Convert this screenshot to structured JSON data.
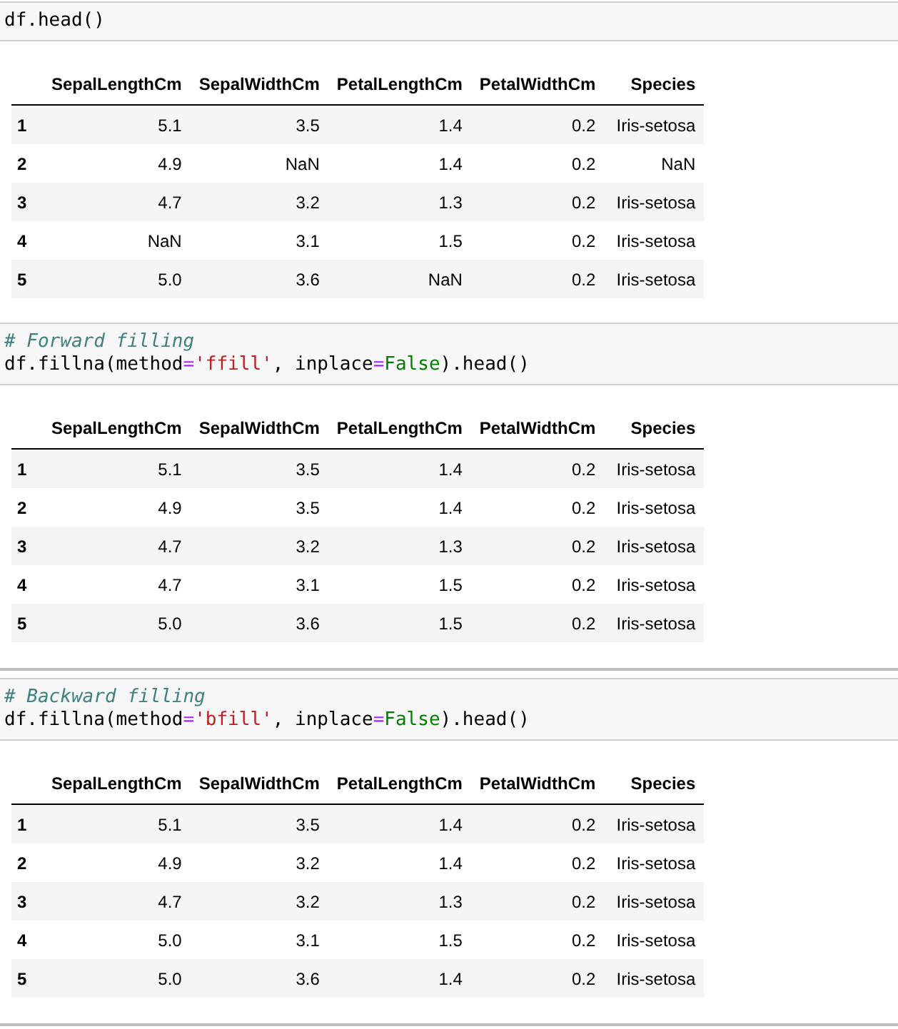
{
  "cells": [
    {
      "code": [
        [
          {
            "kind": "plain",
            "text": "df.head()"
          }
        ]
      ],
      "columns": [
        "SepalLengthCm",
        "SepalWidthCm",
        "PetalLengthCm",
        "PetalWidthCm",
        "Species"
      ],
      "rows": [
        {
          "index": "1",
          "values": [
            "5.1",
            "3.5",
            "1.4",
            "0.2",
            "Iris-setosa"
          ]
        },
        {
          "index": "2",
          "values": [
            "4.9",
            "NaN",
            "1.4",
            "0.2",
            "NaN"
          ]
        },
        {
          "index": "3",
          "values": [
            "4.7",
            "3.2",
            "1.3",
            "0.2",
            "Iris-setosa"
          ]
        },
        {
          "index": "4",
          "values": [
            "NaN",
            "3.1",
            "1.5",
            "0.2",
            "Iris-setosa"
          ]
        },
        {
          "index": "5",
          "values": [
            "5.0",
            "3.6",
            "NaN",
            "0.2",
            "Iris-setosa"
          ]
        }
      ]
    },
    {
      "code": [
        [
          {
            "kind": "comment",
            "text": "# Forward filling"
          }
        ],
        [
          {
            "kind": "plain",
            "text": "df.fillna(method"
          },
          {
            "kind": "operator",
            "text": "="
          },
          {
            "kind": "string",
            "text": "'ffill'"
          },
          {
            "kind": "plain",
            "text": ", inplace"
          },
          {
            "kind": "operator",
            "text": "="
          },
          {
            "kind": "constant",
            "text": "False"
          },
          {
            "kind": "plain",
            "text": ").head()"
          }
        ]
      ],
      "columns": [
        "SepalLengthCm",
        "SepalWidthCm",
        "PetalLengthCm",
        "PetalWidthCm",
        "Species"
      ],
      "rows": [
        {
          "index": "1",
          "values": [
            "5.1",
            "3.5",
            "1.4",
            "0.2",
            "Iris-setosa"
          ]
        },
        {
          "index": "2",
          "values": [
            "4.9",
            "3.5",
            "1.4",
            "0.2",
            "Iris-setosa"
          ]
        },
        {
          "index": "3",
          "values": [
            "4.7",
            "3.2",
            "1.3",
            "0.2",
            "Iris-setosa"
          ]
        },
        {
          "index": "4",
          "values": [
            "4.7",
            "3.1",
            "1.5",
            "0.2",
            "Iris-setosa"
          ]
        },
        {
          "index": "5",
          "values": [
            "5.0",
            "3.6",
            "1.5",
            "0.2",
            "Iris-setosa"
          ]
        }
      ]
    },
    {
      "code": [
        [
          {
            "kind": "comment",
            "text": "# Backward filling"
          }
        ],
        [
          {
            "kind": "plain",
            "text": "df.fillna(method"
          },
          {
            "kind": "operator",
            "text": "="
          },
          {
            "kind": "string",
            "text": "'bfill'"
          },
          {
            "kind": "plain",
            "text": ", inplace"
          },
          {
            "kind": "operator",
            "text": "="
          },
          {
            "kind": "constant",
            "text": "False"
          },
          {
            "kind": "plain",
            "text": ").head()"
          }
        ]
      ],
      "columns": [
        "SepalLengthCm",
        "SepalWidthCm",
        "PetalLengthCm",
        "PetalWidthCm",
        "Species"
      ],
      "rows": [
        {
          "index": "1",
          "values": [
            "5.1",
            "3.5",
            "1.4",
            "0.2",
            "Iris-setosa"
          ]
        },
        {
          "index": "2",
          "values": [
            "4.9",
            "3.2",
            "1.4",
            "0.2",
            "Iris-setosa"
          ]
        },
        {
          "index": "3",
          "values": [
            "4.7",
            "3.2",
            "1.3",
            "0.2",
            "Iris-setosa"
          ]
        },
        {
          "index": "4",
          "values": [
            "5.0",
            "3.1",
            "1.5",
            "0.2",
            "Iris-setosa"
          ]
        },
        {
          "index": "5",
          "values": [
            "5.0",
            "3.6",
            "1.4",
            "0.2",
            "Iris-setosa"
          ]
        }
      ]
    }
  ]
}
